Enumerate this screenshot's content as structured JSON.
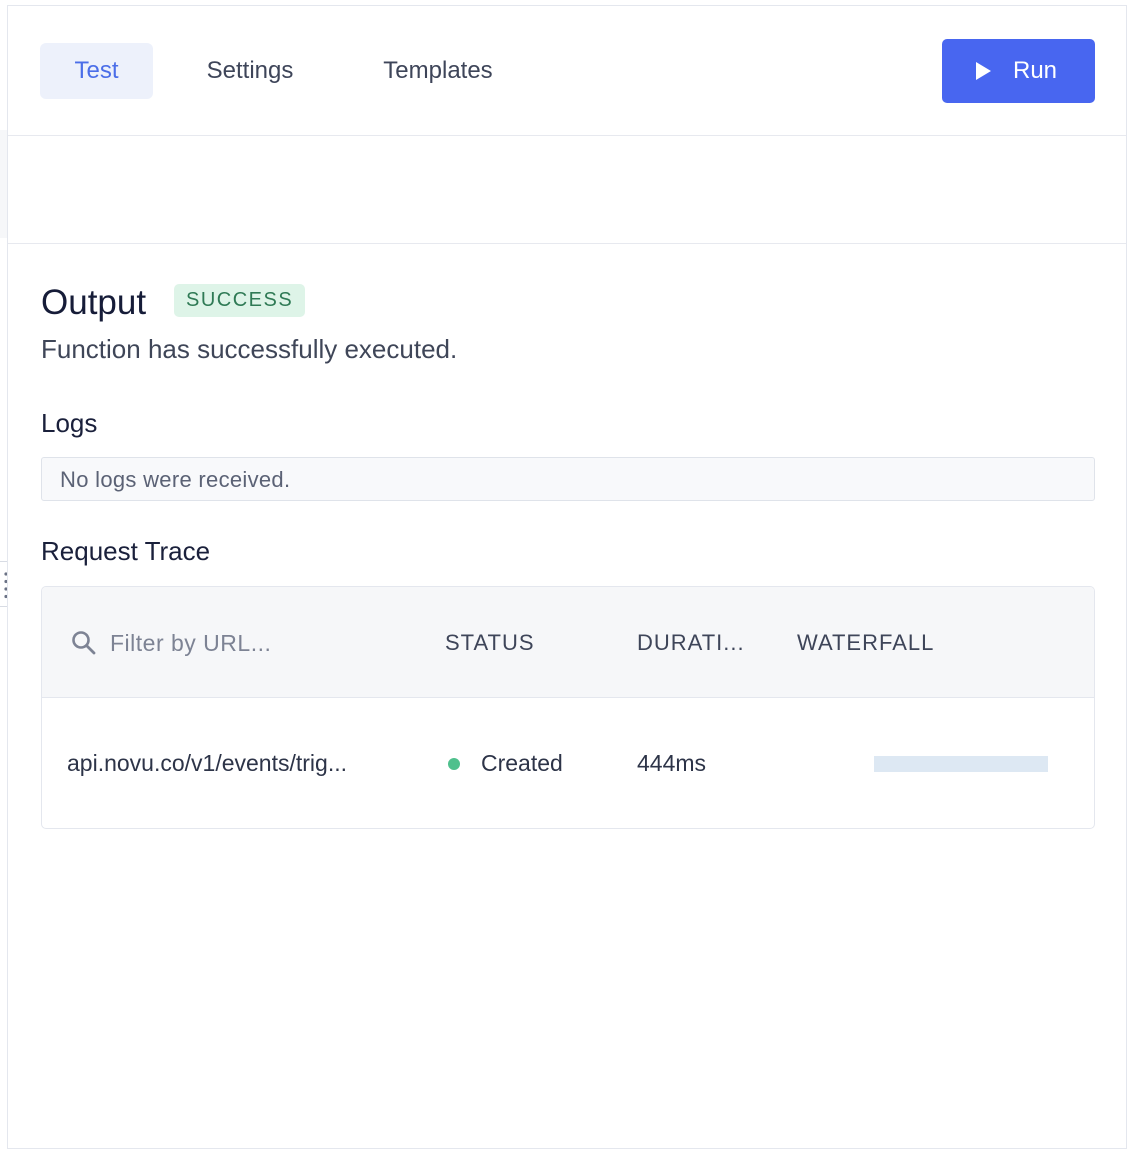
{
  "tabs": [
    {
      "label": "Test",
      "active": true
    },
    {
      "label": "Settings",
      "active": false
    },
    {
      "label": "Templates",
      "active": false
    }
  ],
  "run_button": {
    "label": "Run",
    "icon": "play-icon"
  },
  "output": {
    "title": "Output",
    "status_badge": "SUCCESS",
    "description": "Function has successfully executed."
  },
  "logs": {
    "title": "Logs",
    "message": "No logs were received."
  },
  "request_trace": {
    "title": "Request Trace",
    "filter_placeholder": "Filter by URL...",
    "columns": [
      "STATUS",
      "DURATI...",
      "WATERFALL"
    ],
    "rows": [
      {
        "url": "api.novu.co/v1/events/trig...",
        "status": "Created",
        "status_color": "#4fc08d",
        "duration": "444ms",
        "waterfall_fraction": 1.0
      }
    ]
  },
  "colors": {
    "accent": "#4866f0",
    "success_bg": "#def4e8",
    "success_text": "#2f7a55"
  }
}
